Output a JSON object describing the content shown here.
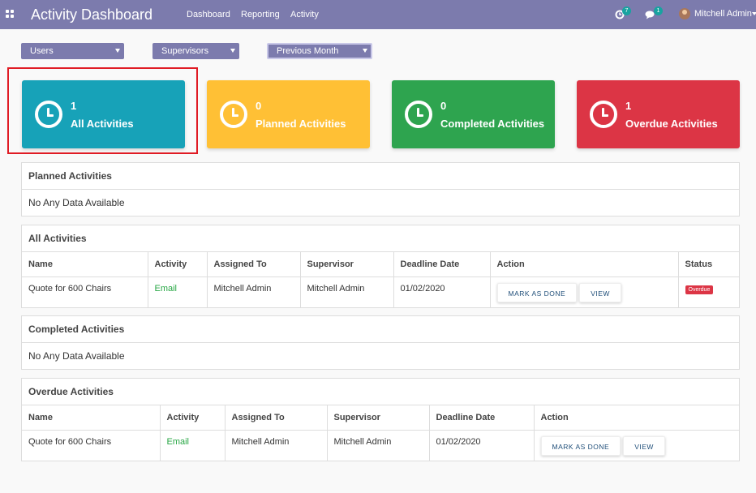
{
  "app": {
    "title": "Activity Dashboard"
  },
  "nav": {
    "menu": [
      "Dashboard",
      "Reporting",
      "Activity"
    ]
  },
  "systray": {
    "activity_count": "7",
    "message_count": "1",
    "user_name": "Mitchell Admin"
  },
  "filters": [
    {
      "label": "Users"
    },
    {
      "label": "Supervisors"
    },
    {
      "label": "Previous Month"
    }
  ],
  "cards": [
    {
      "count": "1",
      "label": "All Activities",
      "color": "#17a2b8"
    },
    {
      "count": "0",
      "label": "Planned Activities",
      "color": "#ffc035"
    },
    {
      "count": "0",
      "label": "Completed Activities",
      "color": "#2ea44f"
    },
    {
      "count": "1",
      "label": "Overdue Activities",
      "color": "#dc3545"
    }
  ],
  "planned": {
    "title": "Planned Activities",
    "empty": "No Any Data Available"
  },
  "all": {
    "title": "All Activities",
    "columns": [
      "Name",
      "Activity",
      "Assigned To",
      "Supervisor",
      "Deadline Date",
      "Action",
      "Status"
    ],
    "rows": [
      {
        "name": "Quote for 600 Chairs",
        "activity": "Email",
        "assigned": "Mitchell Admin",
        "supervisor": "Mitchell Admin",
        "deadline": "01/02/2020",
        "mark_done": "MARK AS DONE",
        "view": "VIEW",
        "status": "Overdue"
      }
    ]
  },
  "completed": {
    "title": "Completed Activities",
    "empty": "No Any Data Available"
  },
  "overdue": {
    "title": "Overdue Activities",
    "columns": [
      "Name",
      "Activity",
      "Assigned To",
      "Supervisor",
      "Deadline Date",
      "Action"
    ],
    "rows": [
      {
        "name": "Quote for 600 Chairs",
        "activity": "Email",
        "assigned": "Mitchell Admin",
        "supervisor": "Mitchell Admin",
        "deadline": "01/02/2020",
        "mark_done": "MARK AS DONE",
        "view": "VIEW"
      }
    ]
  }
}
